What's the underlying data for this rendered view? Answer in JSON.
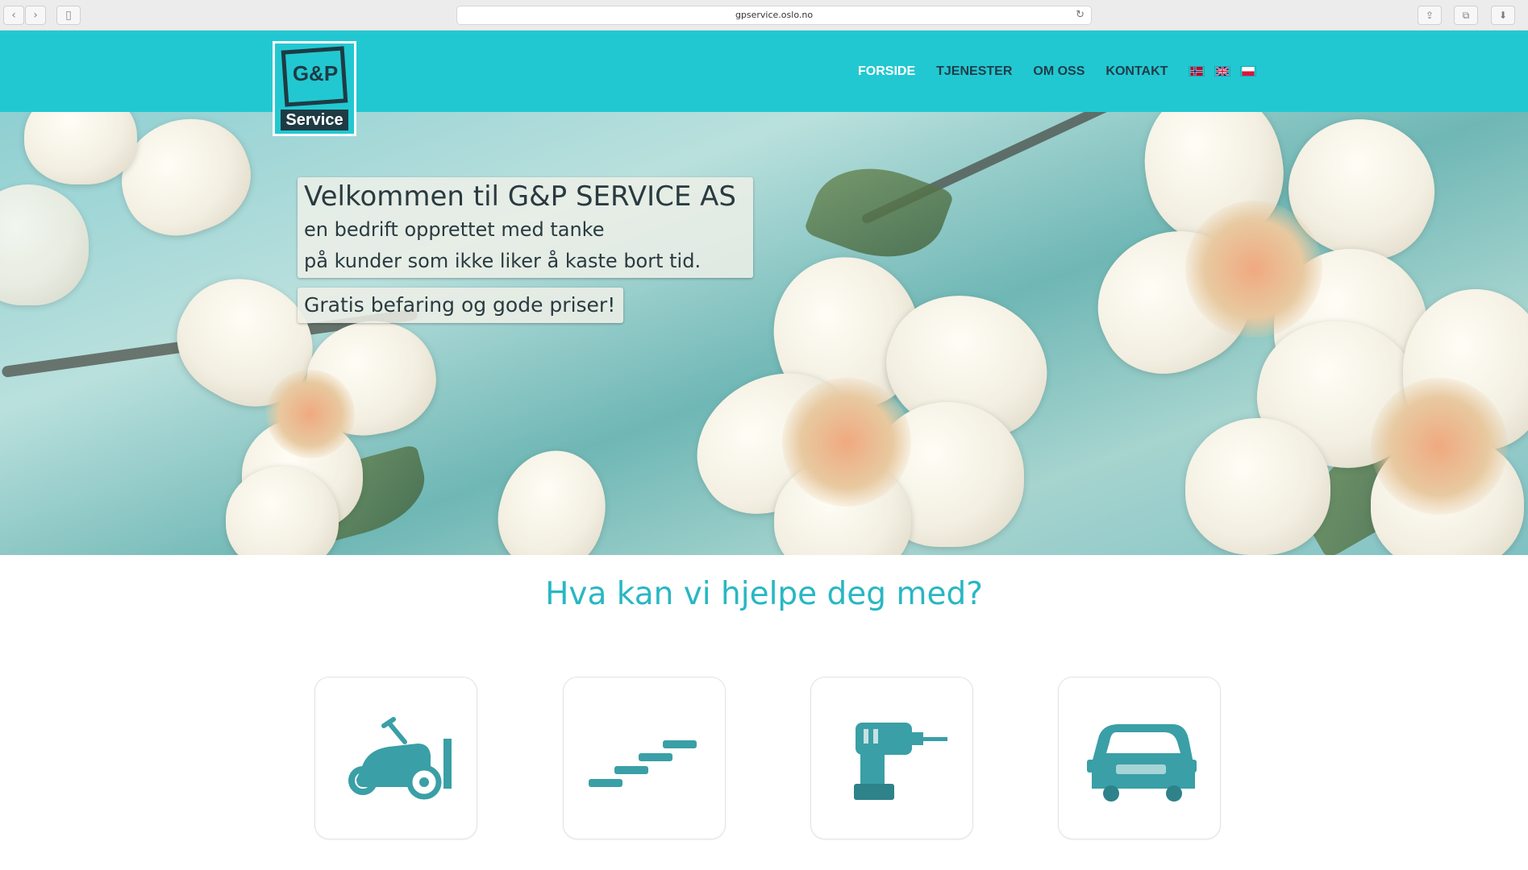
{
  "browser": {
    "url": "gpservice.oslo.no",
    "back_icon": "chevron-left-icon",
    "forward_icon": "chevron-right-icon",
    "sidebar_icon": "sidebar-icon",
    "reload_icon": "reload-icon",
    "share_icon": "share-icon",
    "tabs_icon": "tabs-icon",
    "download_icon": "download-icon"
  },
  "logo": {
    "top_text": "G&P",
    "bottom_text": "Service"
  },
  "nav": {
    "items": [
      {
        "label": "FORSIDE",
        "active": true
      },
      {
        "label": "TJENESTER",
        "active": false
      },
      {
        "label": "OM OSS",
        "active": false
      },
      {
        "label": "KONTAKT",
        "active": false
      }
    ],
    "flags": [
      "norway-flag-icon",
      "uk-flag-icon",
      "poland-flag-icon"
    ]
  },
  "hero": {
    "title": "Velkommen til G&P SERVICE AS",
    "line1": "en bedrift opprettet med tanke",
    "line2": "på kunder som ikke liker å kaste bort tid.",
    "promo": "Gratis befaring og gode priser!",
    "slider_progress_fraction": 0.735
  },
  "services": {
    "heading": "Hva kan vi hjelpe deg med?",
    "cards": [
      {
        "icon": "lawn-mower-icon"
      },
      {
        "icon": "stairs-icon"
      },
      {
        "icon": "drill-icon"
      },
      {
        "icon": "van-icon"
      }
    ]
  },
  "colors": {
    "brand_teal": "#22c8d1",
    "nav_text": "#1f3d49",
    "heading_teal": "#29b7c3",
    "icon_teal": "#3a9fa6"
  }
}
